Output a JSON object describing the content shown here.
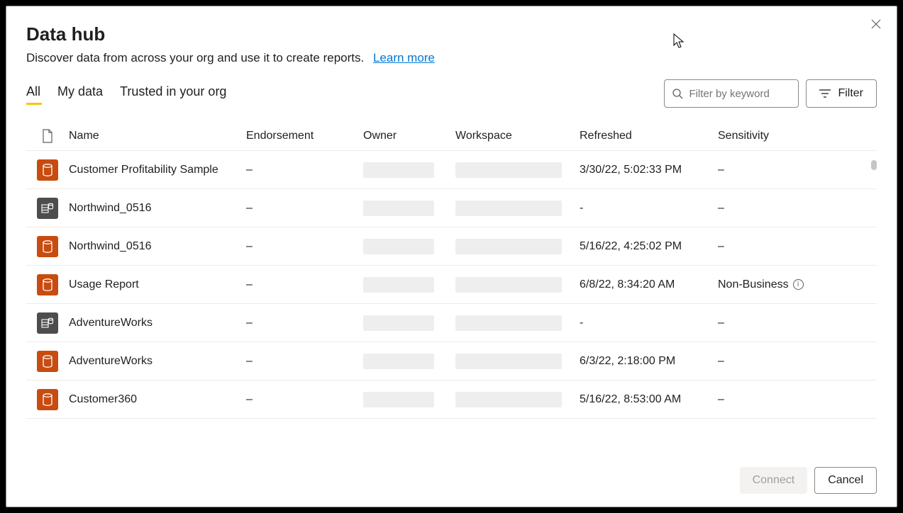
{
  "title": "Data hub",
  "subtitle": "Discover data from across your org and use it to create reports.",
  "learn_more": "Learn more",
  "tabs": [
    {
      "label": "All",
      "selected": true
    },
    {
      "label": "My data",
      "selected": false
    },
    {
      "label": "Trusted in your org",
      "selected": false
    }
  ],
  "search": {
    "placeholder": "Filter by keyword"
  },
  "filter_button": "Filter",
  "columns": {
    "name": "Name",
    "endorsement": "Endorsement",
    "owner": "Owner",
    "workspace": "Workspace",
    "refreshed": "Refreshed",
    "sensitivity": "Sensitivity"
  },
  "rows": [
    {
      "icon_color": "orange",
      "name": "Customer Profitability Sample",
      "endorsement": "–",
      "refreshed": "3/30/22, 5:02:33 PM",
      "sensitivity": "–"
    },
    {
      "icon_color": "gray",
      "name": "Northwind_0516",
      "endorsement": "–",
      "refreshed": "-",
      "sensitivity": "–"
    },
    {
      "icon_color": "orange",
      "name": "Northwind_0516",
      "endorsement": "–",
      "refreshed": "5/16/22, 4:25:02 PM",
      "sensitivity": "–"
    },
    {
      "icon_color": "orange",
      "name": "Usage Report",
      "endorsement": "–",
      "refreshed": "6/8/22, 8:34:20 AM",
      "sensitivity": "Non-Business",
      "info": true
    },
    {
      "icon_color": "gray",
      "name": "AdventureWorks",
      "endorsement": "–",
      "refreshed": "-",
      "sensitivity": "–"
    },
    {
      "icon_color": "orange",
      "name": "AdventureWorks",
      "endorsement": "–",
      "refreshed": "6/3/22, 2:18:00 PM",
      "sensitivity": "–"
    },
    {
      "icon_color": "orange",
      "name": "Customer360",
      "endorsement": "–",
      "refreshed": "5/16/22, 8:53:00 AM",
      "sensitivity": "–"
    }
  ],
  "buttons": {
    "connect": "Connect",
    "cancel": "Cancel"
  }
}
